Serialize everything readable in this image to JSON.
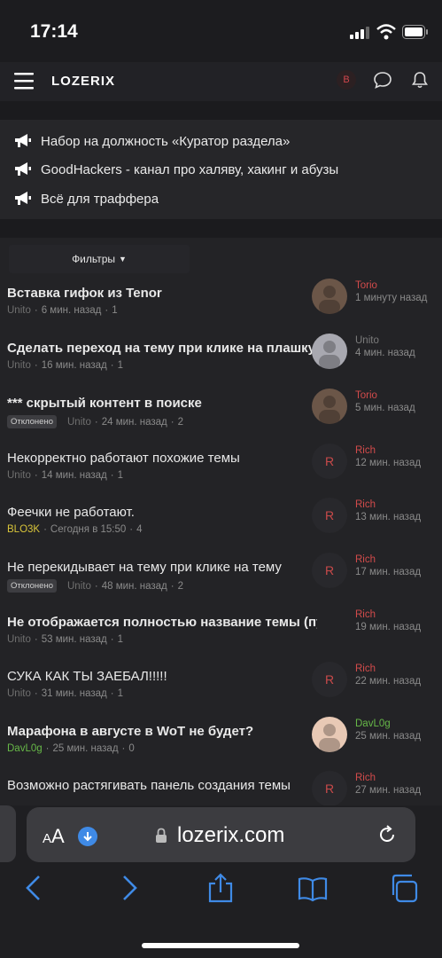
{
  "status": {
    "time": "17:14"
  },
  "nav": {
    "logo": "LOZERIX",
    "avatar_letter": "B"
  },
  "notices": [
    {
      "text": "Набор на должность «Куратор раздела»"
    },
    {
      "text": "GoodHackers - канал про халяву, хакинг и абузы"
    },
    {
      "text": "Всё для траффера"
    }
  ],
  "filters": {
    "label": "Фильтры"
  },
  "threads": [
    {
      "title": "Вставка гифок из Tenor",
      "bold": true,
      "badge": "",
      "author": "Unito",
      "author_color": "grey",
      "time": "6 мин. назад",
      "replies": "1",
      "avatar": "photo-icon",
      "last_user": "Torio",
      "last_user_color": "red",
      "last_time": "1 минуту назад"
    },
    {
      "title": "Сделать переход на тему при клике на плашку",
      "bold": true,
      "badge": "",
      "author": "Unito",
      "author_color": "grey",
      "time": "16 мин. назад",
      "replies": "1",
      "avatar": "photo-icon",
      "last_user": "Unito",
      "last_user_color": "grey",
      "last_time": "4 мин. назад"
    },
    {
      "title": "*** скрытый контент в поиске",
      "bold": true,
      "badge": "Отклонено",
      "author": "Unito",
      "author_color": "grey",
      "time": "24 мин. назад",
      "replies": "2",
      "avatar": "photo-icon",
      "last_user": "Torio",
      "last_user_color": "red",
      "last_time": "5 мин. назад"
    },
    {
      "title": "Некорректно работают похожие темы",
      "bold": false,
      "badge": "",
      "author": "Unito",
      "author_color": "grey",
      "time": "14 мин. назад",
      "replies": "1",
      "avatar": "R",
      "last_user": "Rich",
      "last_user_color": "red",
      "last_time": "12 мин. назад"
    },
    {
      "title": "Феечки не работают.",
      "bold": false,
      "badge": "",
      "author": "BLO3K",
      "author_color": "yellow",
      "time": "Сегодня в 15:50",
      "replies": "4",
      "avatar": "R",
      "last_user": "Rich",
      "last_user_color": "red",
      "last_time": "13 мин. назад"
    },
    {
      "title": "Не перекидывает на тему при клике на тему",
      "bold": false,
      "badge": "Отклонено",
      "author": "Unito",
      "author_color": "grey",
      "time": "48 мин. назад",
      "replies": "2",
      "avatar": "R",
      "last_user": "Rich",
      "last_user_color": "red",
      "last_time": "17 мин. назад"
    },
    {
      "title": "Не отображается полностью название темы (пустое п...",
      "bold": true,
      "badge": "",
      "author": "Unito",
      "author_color": "grey",
      "time": "53 мин. назад",
      "replies": "1",
      "avatar": "",
      "last_user": "Rich",
      "last_user_color": "red",
      "last_time": "19 мин. назад"
    },
    {
      "title": "СУКА КАК ТЫ ЗАЕБАЛ!!!!!",
      "bold": false,
      "badge": "",
      "author": "Unito",
      "author_color": "grey",
      "time": "31 мин. назад",
      "replies": "1",
      "avatar": "R",
      "last_user": "Rich",
      "last_user_color": "red",
      "last_time": "22 мин. назад"
    },
    {
      "title": "Марафона в августе в WoT не будет?",
      "bold": true,
      "badge": "",
      "author": "DavL0g",
      "author_color": "green",
      "time": "25 мин. назад",
      "replies": "0",
      "avatar": "photo-icon",
      "last_user": "DavL0g",
      "last_user_color": "green",
      "last_time": "25 мин. назад"
    },
    {
      "title": "Возможно растягивать панель создания темы",
      "bold": false,
      "badge": "",
      "author": "",
      "author_color": "grey",
      "time": "",
      "replies": "",
      "avatar": "R",
      "last_user": "Rich",
      "last_user_color": "red",
      "last_time": "27 мин. назад"
    }
  ],
  "safari": {
    "text_size": "AA",
    "url": "lozerix.com"
  }
}
